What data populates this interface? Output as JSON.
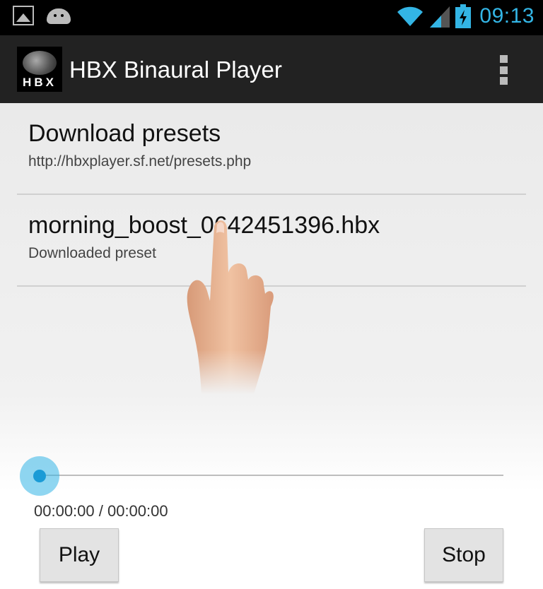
{
  "status_bar": {
    "time": "09:13",
    "left_icons": [
      "gallery-icon",
      "android-icon"
    ],
    "right_icons": [
      "wifi-icon",
      "signal-icon",
      "battery-charging-icon"
    ],
    "accent_color": "#33b5e5"
  },
  "action_bar": {
    "logo_text": "HBX",
    "title": "HBX Binaural Player",
    "background": "#222222"
  },
  "preferences": [
    {
      "title": "Download presets",
      "summary": "http://hbxplayer.sf.net/presets.php"
    },
    {
      "title": "morning_boost_0642451396.hbx",
      "summary": "Downloaded preset"
    }
  ],
  "player": {
    "progress": 0,
    "time_readout": "00:00:00 / 00:00:00",
    "play_label": "Play",
    "stop_label": "Stop"
  }
}
